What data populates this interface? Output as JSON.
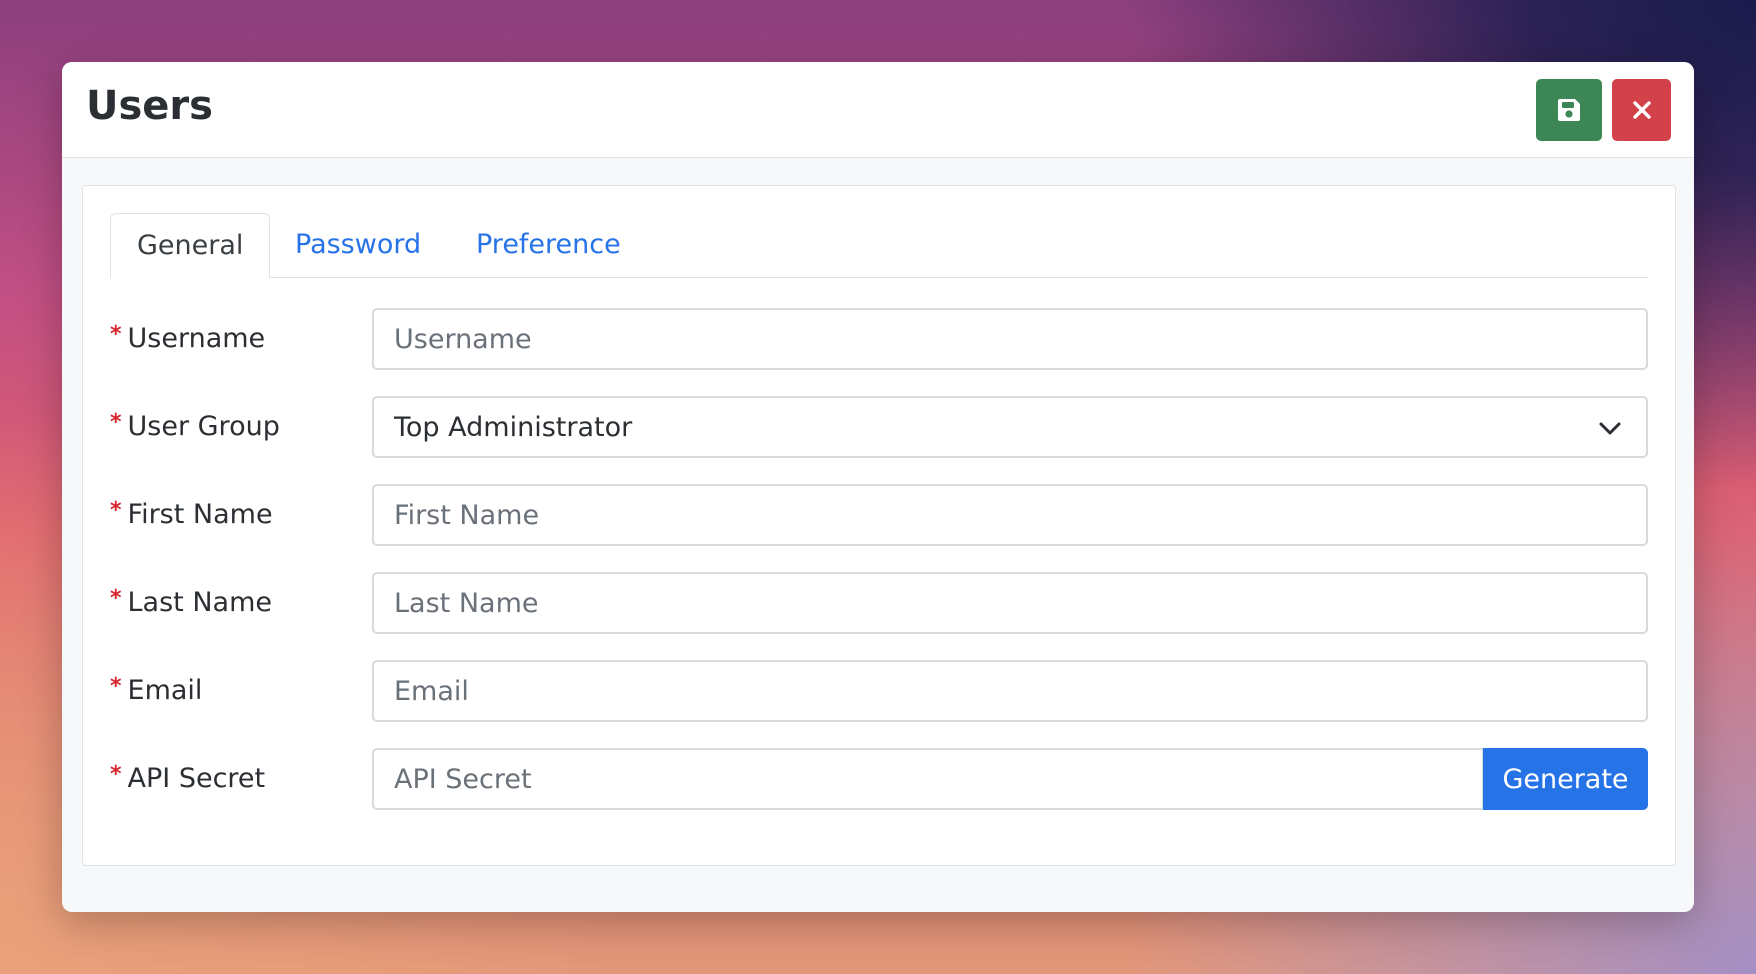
{
  "modal": {
    "title": "Users"
  },
  "header": {
    "save_icon": "floppy-disk-icon",
    "close_icon": "close-x-icon",
    "colors": {
      "save": "#3c8755",
      "close": "#d3414a"
    }
  },
  "tabs": [
    {
      "label": "General",
      "active": true
    },
    {
      "label": "Password",
      "active": false
    },
    {
      "label": "Preference",
      "active": false
    }
  ],
  "form": {
    "required_marker": "*",
    "username": {
      "label": "Username",
      "placeholder": "Username",
      "value": ""
    },
    "user_group": {
      "label": "User Group",
      "value": "Top Administrator"
    },
    "first_name": {
      "label": "First Name",
      "placeholder": "First Name",
      "value": ""
    },
    "last_name": {
      "label": "Last Name",
      "placeholder": "Last Name",
      "value": ""
    },
    "email": {
      "label": "Email",
      "placeholder": "Email",
      "value": ""
    },
    "api_secret": {
      "label": "API Secret",
      "placeholder": "API Secret",
      "value": "",
      "button": "Generate"
    }
  },
  "colors": {
    "accent": "#2673e8",
    "required": "#d4242c"
  }
}
